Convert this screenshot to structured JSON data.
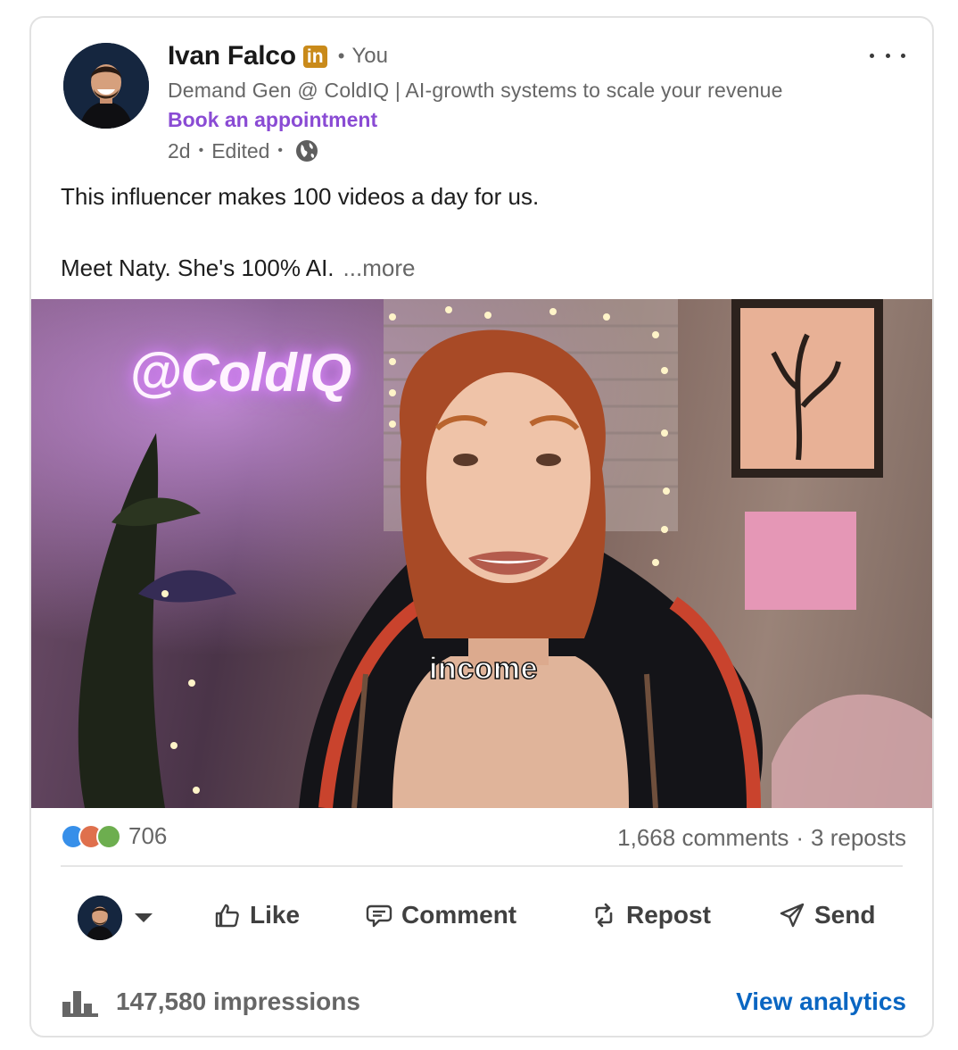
{
  "post": {
    "author": {
      "name": "Ivan Falco",
      "linkedin_badge": "in",
      "relation": "You",
      "headline": "Demand Gen @ ColdIQ | AI-growth systems to scale your revenue",
      "cta_link": "Book an appointment",
      "age": "2d",
      "edited": "Edited",
      "visibility_icon": "globe-icon"
    },
    "text": {
      "line1": "This influencer makes 100 videos a day for us.",
      "line2": "Meet Naty. She's 100% AI.",
      "see_more": "...more"
    },
    "media": {
      "neon_sign": "@ColdIQ",
      "caption": "income"
    },
    "social": {
      "reaction_icons": [
        "like-reaction-icon",
        "love-reaction-icon",
        "celebrate-reaction-icon"
      ],
      "reaction_colors": [
        "#378fe9",
        "#df704d",
        "#6dae4f"
      ],
      "reaction_count": "706",
      "comments": "1,668 comments",
      "reposts": "3 reposts"
    },
    "actions": {
      "like": "Like",
      "comment": "Comment",
      "repost": "Repost",
      "send": "Send"
    },
    "footer": {
      "impressions": "147,580 impressions",
      "analytics_link": "View analytics"
    }
  },
  "colors": {
    "link_purple": "#8a4bd4",
    "link_blue": "#0a66c2",
    "badge_gold": "#c98a1a"
  }
}
